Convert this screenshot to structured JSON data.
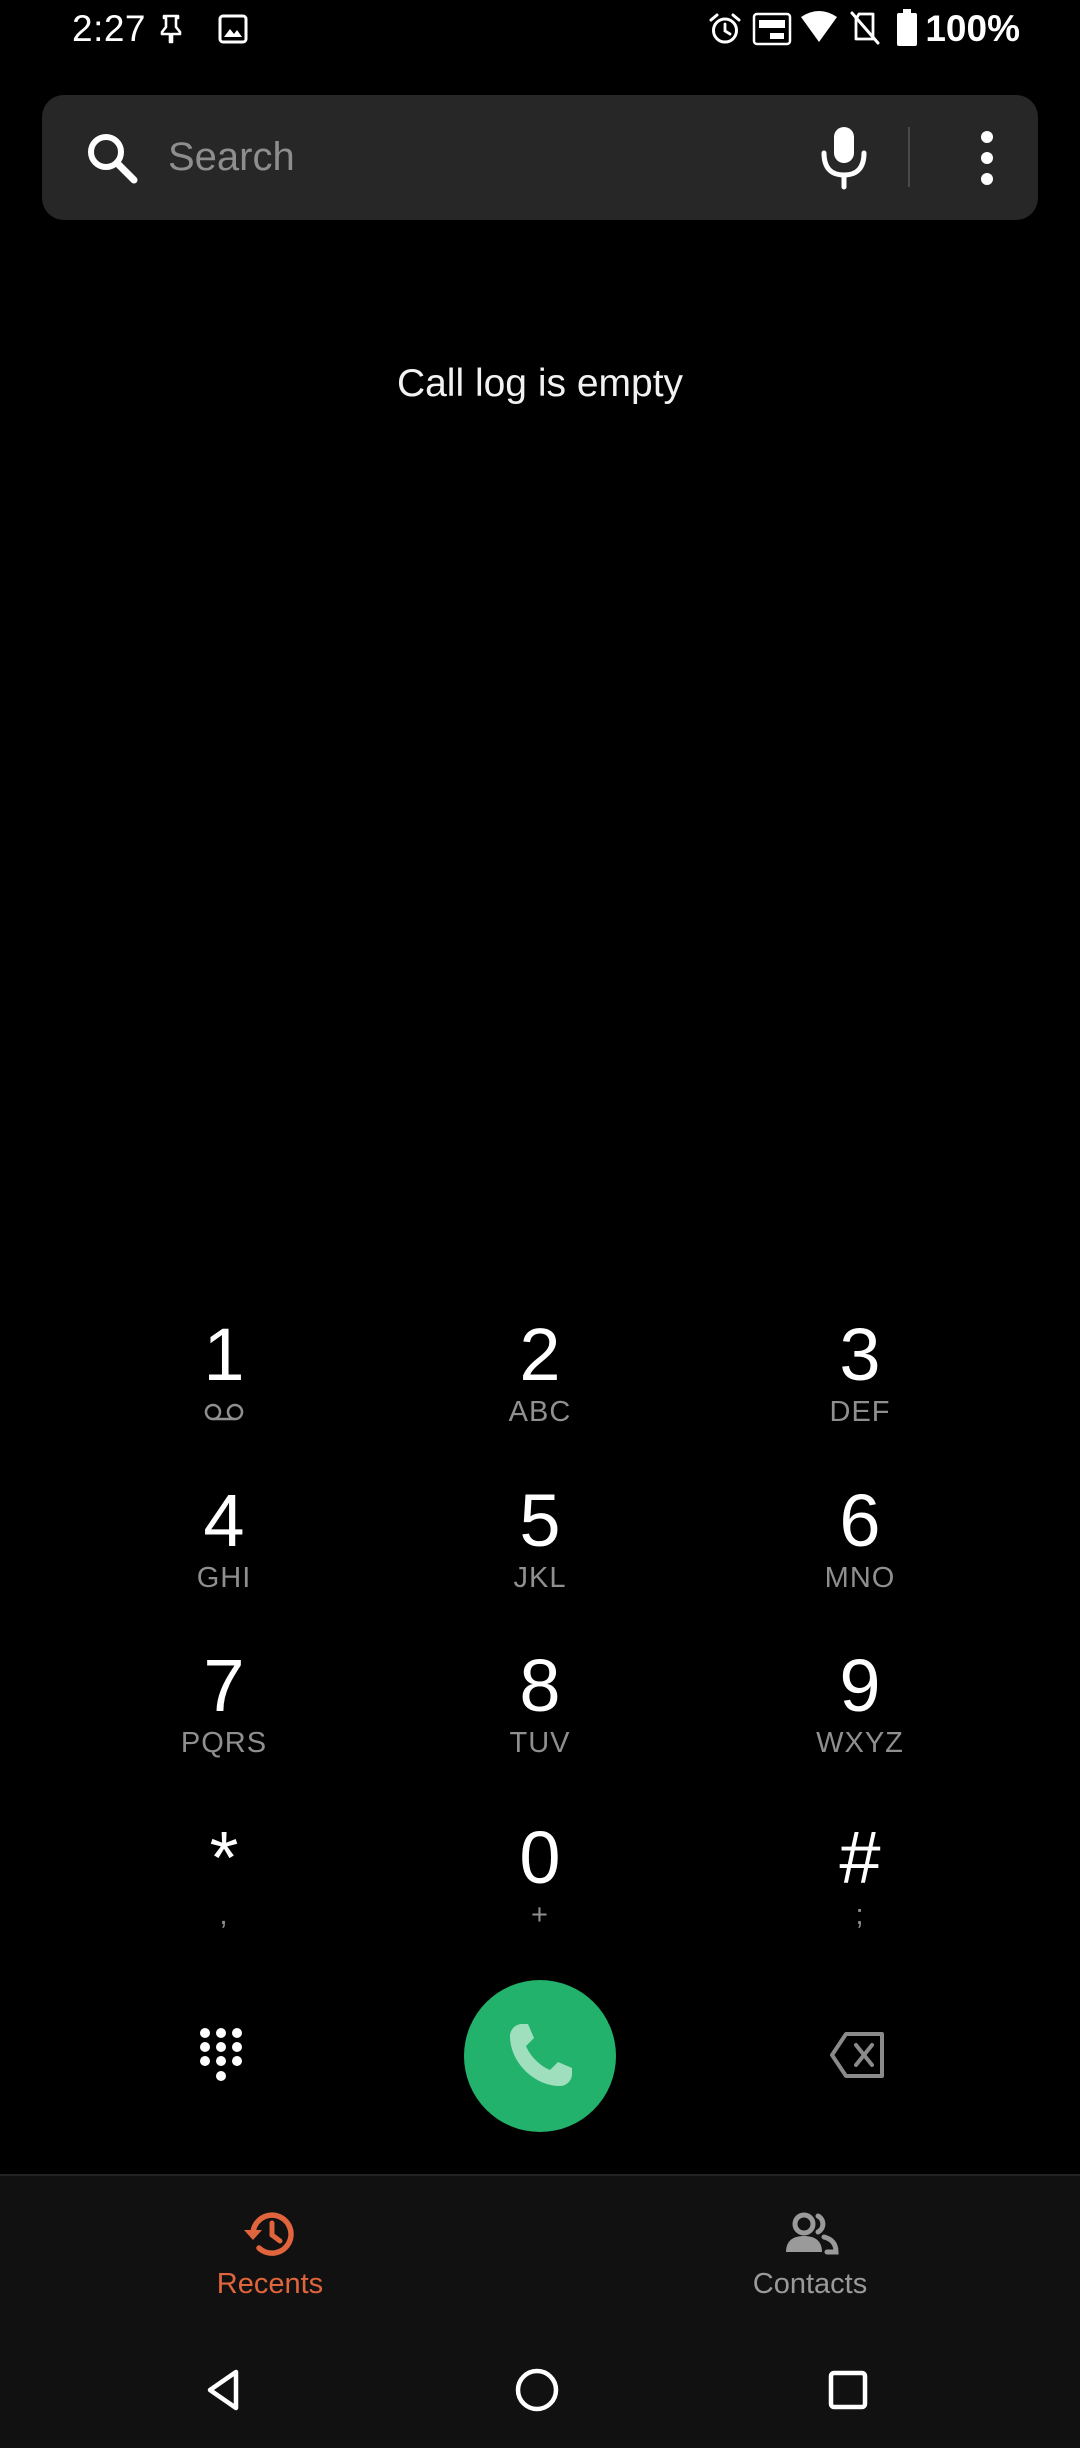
{
  "status_bar": {
    "time": "2:27",
    "battery": "100%",
    "icons": [
      "pin-icon",
      "image-icon",
      "alarm-icon",
      "auto-hz-icon",
      "wifi-icon",
      "no-sim-icon",
      "battery-icon"
    ]
  },
  "search": {
    "placeholder": "Search",
    "value": "",
    "icons": [
      "search-icon",
      "mic-icon",
      "more-icon"
    ]
  },
  "call_log": {
    "empty_message": "Call log is empty"
  },
  "dialpad": {
    "keys": [
      {
        "digit": "1",
        "letters": "",
        "icon": "voicemail-icon"
      },
      {
        "digit": "2",
        "letters": "ABC"
      },
      {
        "digit": "3",
        "letters": "DEF"
      },
      {
        "digit": "4",
        "letters": "GHI"
      },
      {
        "digit": "5",
        "letters": "JKL"
      },
      {
        "digit": "6",
        "letters": "MNO"
      },
      {
        "digit": "7",
        "letters": "PQRS"
      },
      {
        "digit": "8",
        "letters": "TUV"
      },
      {
        "digit": "9",
        "letters": "WXYZ"
      },
      {
        "digit": "*",
        "letters": ","
      },
      {
        "digit": "0",
        "letters": "+"
      },
      {
        "digit": "#",
        "letters": ";"
      }
    ]
  },
  "actions": {
    "icons": [
      "keypad-icon",
      "phone-icon",
      "backspace-icon"
    ],
    "call_color": "#22b26c"
  },
  "bottom_nav": {
    "tabs": [
      {
        "label": "Recents",
        "icon": "history-icon",
        "active": true,
        "color": "#e0643c"
      },
      {
        "label": "Contacts",
        "icon": "contacts-icon",
        "active": false,
        "color": "#9a9a9a"
      }
    ]
  },
  "system_nav": {
    "icons": [
      "back-icon",
      "home-icon",
      "recents-icon"
    ]
  }
}
